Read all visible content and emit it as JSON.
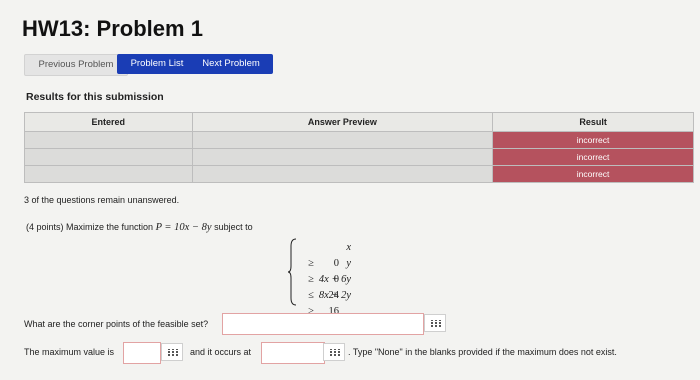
{
  "page": {
    "title": "HW13: Problem 1"
  },
  "nav": {
    "previous_label": "Previous Problem",
    "list_label": "Problem List",
    "next_label": "Next Problem"
  },
  "results": {
    "heading": "Results for this submission",
    "columns": [
      "Entered",
      "Answer Preview",
      "Result"
    ],
    "rows": [
      {
        "entered": "",
        "preview": "",
        "result": "incorrect"
      },
      {
        "entered": "",
        "preview": "",
        "result": "incorrect"
      },
      {
        "entered": "",
        "preview": "",
        "result": "incorrect"
      }
    ],
    "result_color": "#b5525e"
  },
  "status": {
    "remaining": "3 of the questions remain unanswered."
  },
  "problem": {
    "intro": "(4 points) Maximize the function",
    "objective": "P = 10x − 8y",
    "subject_to": "subject to",
    "constraints": [
      {
        "lhs": "x",
        "op": "≥",
        "rhs": "0"
      },
      {
        "lhs": "y",
        "op": "≥",
        "rhs": "0"
      },
      {
        "lhs": "4x + 6y",
        "op": "≤",
        "rhs": "24"
      },
      {
        "lhs": "8x + 2y",
        "op": "≥",
        "rhs": "16"
      }
    ]
  },
  "questions": {
    "corner_points": "What are the corner points of the feasible set?",
    "max_value": "The maximum value is",
    "occurs_at": "and it occurs at",
    "note": ". Type \"None\" in the blanks provided if the maximum does not exist."
  },
  "inputs": {
    "corner_value": "",
    "max_value": "",
    "at_value": ""
  },
  "icons": {
    "answer_palette": "grid-icon"
  },
  "colors": {
    "primary_button": "#1a3db5"
  }
}
